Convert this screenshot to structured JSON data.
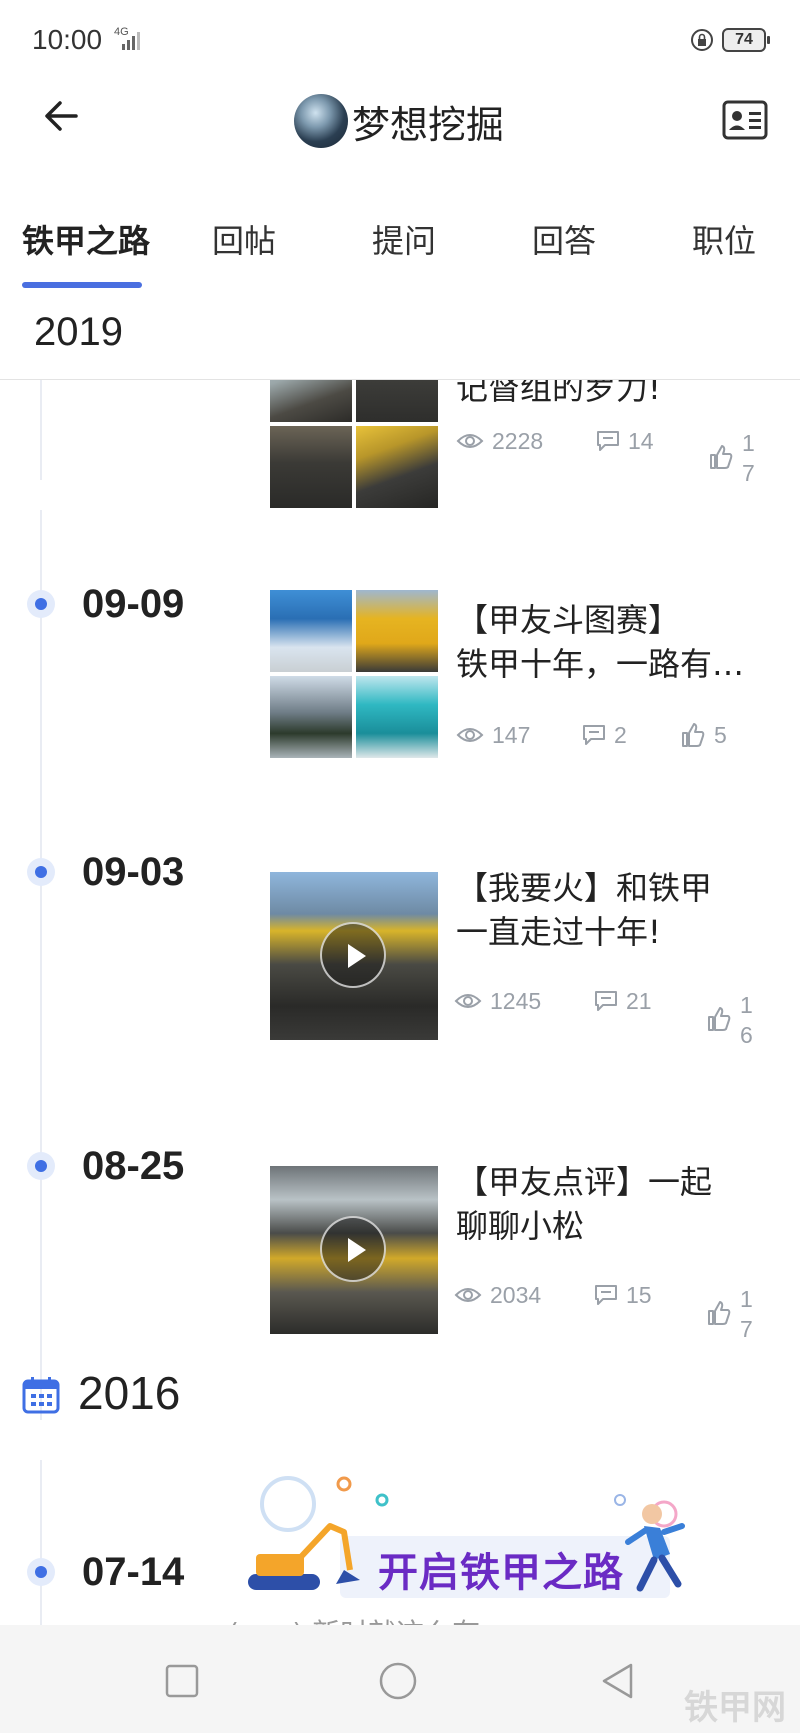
{
  "status_bar": {
    "time": "10:00",
    "network": "4G",
    "battery": "74"
  },
  "header": {
    "title": "梦想挖掘"
  },
  "tabs": [
    {
      "label": "铁甲之路"
    },
    {
      "label": "回帖"
    },
    {
      "label": "提问"
    },
    {
      "label": "回答"
    },
    {
      "label": "职位"
    }
  ],
  "sticky_year": "2019",
  "posts": [
    {
      "date": "",
      "title_line1": "记督组的罗力!",
      "title_line2": "",
      "views": "2228",
      "comments": "14",
      "likes": "17"
    },
    {
      "date": "09-09",
      "title_line1": "【甲友斗图赛】",
      "title_line2": "铁甲十年，一路有…",
      "views": "147",
      "comments": "2",
      "likes": "5"
    },
    {
      "date": "09-03",
      "title_line1": "【我要火】和铁甲",
      "title_line2": "一直走过十年!",
      "views": "1245",
      "comments": "21",
      "likes": "16"
    },
    {
      "date": "08-25",
      "title_line1": "【甲友点评】一起",
      "title_line2": "聊聊小松",
      "views": "2034",
      "comments": "15",
      "likes": "17"
    }
  ],
  "year_2016": "2016",
  "post_2016": {
    "date": "07-14",
    "banner_text": "开启铁甲之路",
    "caption": "(......) 新时就这么有一"
  },
  "watermark": "铁甲网",
  "colors": {
    "accent": "#4a6fe0",
    "dot": "#3f6fe4",
    "stat_gray": "#9aa0a8"
  }
}
